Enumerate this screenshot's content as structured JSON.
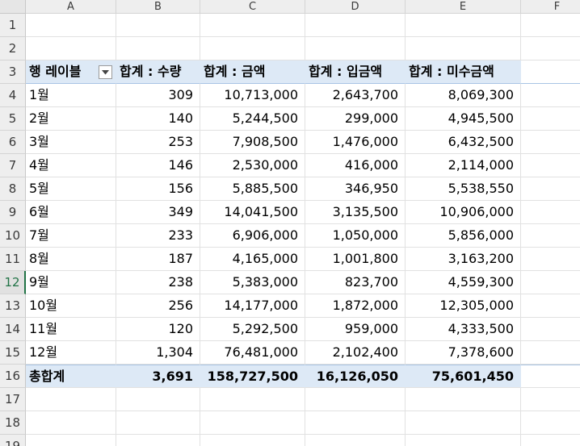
{
  "columns": [
    "A",
    "B",
    "C",
    "D",
    "E",
    "F"
  ],
  "rows": [
    "1",
    "2",
    "3",
    "4",
    "5",
    "6",
    "7",
    "8",
    "9",
    "10",
    "11",
    "12",
    "13",
    "14",
    "15",
    "16",
    "17",
    "18",
    "19"
  ],
  "pivot": {
    "headers": {
      "row_label": "행 레이블",
      "qty": "합계 : 수량",
      "amount": "합계 : 금액",
      "paid": "합계 : 입금액",
      "unpaid": "합계 : 미수금액"
    },
    "data": [
      {
        "label": "1월",
        "qty": "309",
        "amount": "10,713,000",
        "paid": "2,643,700",
        "unpaid": "8,069,300"
      },
      {
        "label": "2월",
        "qty": "140",
        "amount": "5,244,500",
        "paid": "299,000",
        "unpaid": "4,945,500"
      },
      {
        "label": "3월",
        "qty": "253",
        "amount": "7,908,500",
        "paid": "1,476,000",
        "unpaid": "6,432,500"
      },
      {
        "label": "4월",
        "qty": "146",
        "amount": "2,530,000",
        "paid": "416,000",
        "unpaid": "2,114,000"
      },
      {
        "label": "5월",
        "qty": "156",
        "amount": "5,885,500",
        "paid": "346,950",
        "unpaid": "5,538,550"
      },
      {
        "label": "6월",
        "qty": "349",
        "amount": "14,041,500",
        "paid": "3,135,500",
        "unpaid": "10,906,000"
      },
      {
        "label": "7월",
        "qty": "233",
        "amount": "6,906,000",
        "paid": "1,050,000",
        "unpaid": "5,856,000"
      },
      {
        "label": "8월",
        "qty": "187",
        "amount": "4,165,000",
        "paid": "1,001,800",
        "unpaid": "3,163,200"
      },
      {
        "label": "9월",
        "qty": "238",
        "amount": "5,383,000",
        "paid": "823,700",
        "unpaid": "4,559,300"
      },
      {
        "label": "10월",
        "qty": "256",
        "amount": "14,177,000",
        "paid": "1,872,000",
        "unpaid": "12,305,000"
      },
      {
        "label": "11월",
        "qty": "120",
        "amount": "5,292,500",
        "paid": "959,000",
        "unpaid": "4,333,500"
      },
      {
        "label": "12월",
        "qty": "1,304",
        "amount": "76,481,000",
        "paid": "2,102,400",
        "unpaid": "7,378,600"
      }
    ],
    "total": {
      "label": "총합계",
      "qty": "3,691",
      "amount": "158,727,500",
      "paid": "16,126,050",
      "unpaid": "75,601,450"
    }
  },
  "icons": {
    "filter": "filter-dropdown-icon"
  },
  "colors": {
    "pivot_band": "#dde9f6",
    "header_bg": "#eeeeee",
    "selected_row_accent": "#217346"
  }
}
